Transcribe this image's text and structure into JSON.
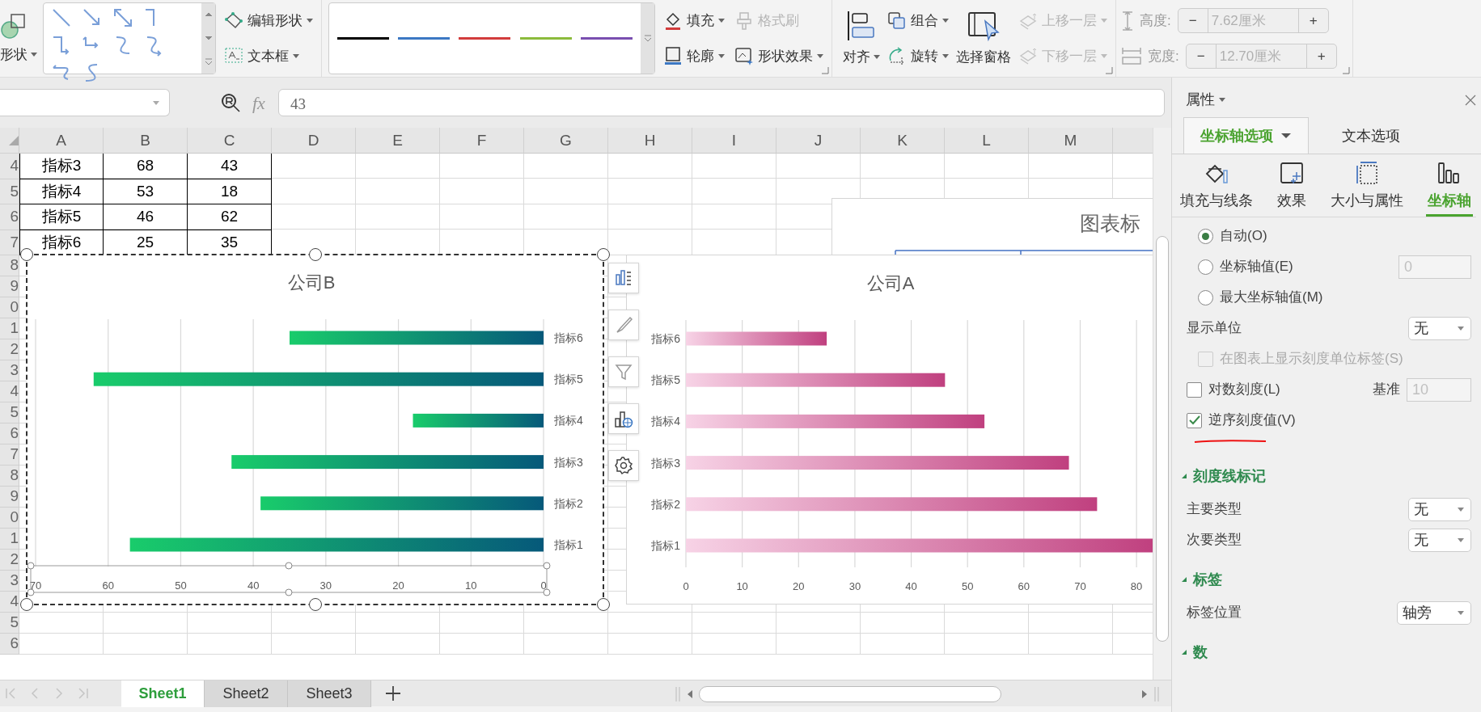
{
  "ribbon": {
    "shape_button": {
      "label": "形状",
      "dropdown": true
    },
    "edit_shape": {
      "label": "编辑形状",
      "dropdown": true
    },
    "text_box": {
      "label": "文本框",
      "dropdown": true
    },
    "line_styles": [
      {
        "color": "#000000"
      },
      {
        "color": "#3c78c3"
      },
      {
        "color": "#d23c3c"
      },
      {
        "color": "#8bbb3c"
      },
      {
        "color": "#7a4fb0"
      }
    ],
    "fill": {
      "label": "填充",
      "dropdown": true,
      "disabled": false
    },
    "format_painter": {
      "label": "格式刷",
      "dropdown": false,
      "disabled": true
    },
    "outline": {
      "label": "轮廓",
      "dropdown": true,
      "disabled": false
    },
    "shape_effects": {
      "label": "形状效果",
      "dropdown": true,
      "disabled": false
    },
    "align": {
      "label": "对齐",
      "dropdown": true
    },
    "group": {
      "label": "组合",
      "dropdown": true,
      "disabled": false
    },
    "rotate": {
      "label": "旋转",
      "dropdown": true,
      "disabled": false
    },
    "selection_pane": {
      "label": "选择窗格"
    },
    "bring_forward": {
      "label": "上移一层",
      "dropdown": true,
      "disabled": true
    },
    "send_backward": {
      "label": "下移一层",
      "dropdown": true,
      "disabled": true
    },
    "size_fields": [
      {
        "label": "高度:",
        "value": "7.62厘米",
        "minus": "−",
        "plus": "+",
        "disabled": true
      },
      {
        "label": "宽度:",
        "value": "12.70厘米",
        "minus": "−",
        "plus": "+",
        "disabled": true
      }
    ]
  },
  "formula_bar": {
    "function_label": "fx",
    "formula": "43"
  },
  "sheet": {
    "columns": [
      "A",
      "B",
      "C",
      "D",
      "E",
      "F",
      "G",
      "H",
      "I",
      "J",
      "K",
      "L",
      "M"
    ],
    "row_headers": [
      "4",
      "5",
      "6",
      "7",
      "8",
      "9",
      "0",
      "1",
      "2",
      "3",
      "4",
      "5",
      "6",
      "7",
      "8",
      "9",
      "0",
      "1",
      "2",
      "3",
      "4",
      "5",
      "6"
    ],
    "cells": [
      [
        "指标3",
        "68",
        "43"
      ],
      [
        "指标4",
        "53",
        "18"
      ],
      [
        "指标5",
        "46",
        "62"
      ],
      [
        "指标6",
        "25",
        "35"
      ]
    ]
  },
  "background_chart": {
    "title": "图表标"
  },
  "charts": [
    {
      "title": "公司B",
      "selected": true,
      "axis_selected": true,
      "bar_start": {
        "color": "#19cc6b"
      },
      "chart_data": {
        "type": "bar",
        "orientation": "horizontal",
        "grid": true,
        "categories": [
          "指标6",
          "指标5",
          "指标4",
          "指标3",
          "指标2",
          "指标1"
        ],
        "series": [
          {
            "color": "#06597a",
            "values": [
              35,
              62,
              18,
              43,
              39,
              57
            ]
          }
        ],
        "xlim": [
          70,
          0
        ],
        "xticks": [
          70,
          60,
          50,
          40,
          30,
          20,
          10,
          0
        ]
      }
    },
    {
      "title": "公司A",
      "selected": false,
      "axis_selected": false,
      "bar_start": {
        "color": "#f7d3e6"
      },
      "chart_data": {
        "type": "bar",
        "orientation": "horizontal",
        "grid": true,
        "categories": [
          "指标6",
          "指标5",
          "指标4",
          "指标3",
          "指标2",
          "指标1"
        ],
        "series": [
          {
            "color": "#c0407f",
            "values": [
              25,
              46,
              53,
              68,
              73,
              83
            ]
          }
        ],
        "xlim": [
          0,
          83
        ],
        "xticks": [
          0,
          10,
          20,
          30,
          40,
          50,
          60,
          70,
          80
        ]
      }
    }
  ],
  "sheet_tabs": [
    {
      "label": "Sheet1",
      "selected": true
    },
    {
      "label": "Sheet2",
      "selected": false
    },
    {
      "label": "Sheet3",
      "selected": false
    }
  ],
  "panel": {
    "title": "属性",
    "tabs": [
      {
        "label": "坐标轴选项",
        "selected": true,
        "dropdown": true
      },
      {
        "label": "文本选项",
        "selected": false,
        "dropdown": false
      }
    ],
    "subtabs": [
      {
        "label": "填充与线条",
        "selected": false
      },
      {
        "label": "效果",
        "selected": false
      },
      {
        "label": "大小与属性",
        "selected": false
      },
      {
        "label": "坐标轴",
        "selected": true
      }
    ],
    "options": [
      {
        "kind": "radio",
        "label": "自动(O)",
        "selected": true
      },
      {
        "kind": "radio",
        "label": "坐标轴值(E)",
        "selected": false,
        "input": "0",
        "input_disabled": true
      },
      {
        "kind": "radio",
        "label": "最大坐标轴值(M)",
        "selected": false
      },
      {
        "kind": "select",
        "label": "显示单位",
        "value": "无"
      },
      {
        "kind": "checkbox",
        "label": "在图表上显示刻度单位标签(S)",
        "checked": false,
        "disabled": true,
        "annotated": false
      },
      {
        "kind": "checkbox",
        "label": "对数刻度(L)",
        "checked": false,
        "disabled": false,
        "annotated": false,
        "side_label": "基准",
        "input": "10",
        "input_disabled": true
      },
      {
        "kind": "checkbox",
        "label": "逆序刻度值(V)",
        "checked": true,
        "disabled": false,
        "annotated": true
      },
      {
        "kind": "section",
        "label": "刻度线标记",
        "expanded": true
      },
      {
        "kind": "select",
        "label": "主要类型",
        "value": "无"
      },
      {
        "kind": "select",
        "label": "次要类型",
        "value": "无"
      },
      {
        "kind": "section",
        "label": "标签",
        "expanded": true
      },
      {
        "kind": "select",
        "label": "标签位置",
        "value": "轴旁"
      },
      {
        "kind": "section",
        "label": "数",
        "expanded": true
      }
    ]
  }
}
